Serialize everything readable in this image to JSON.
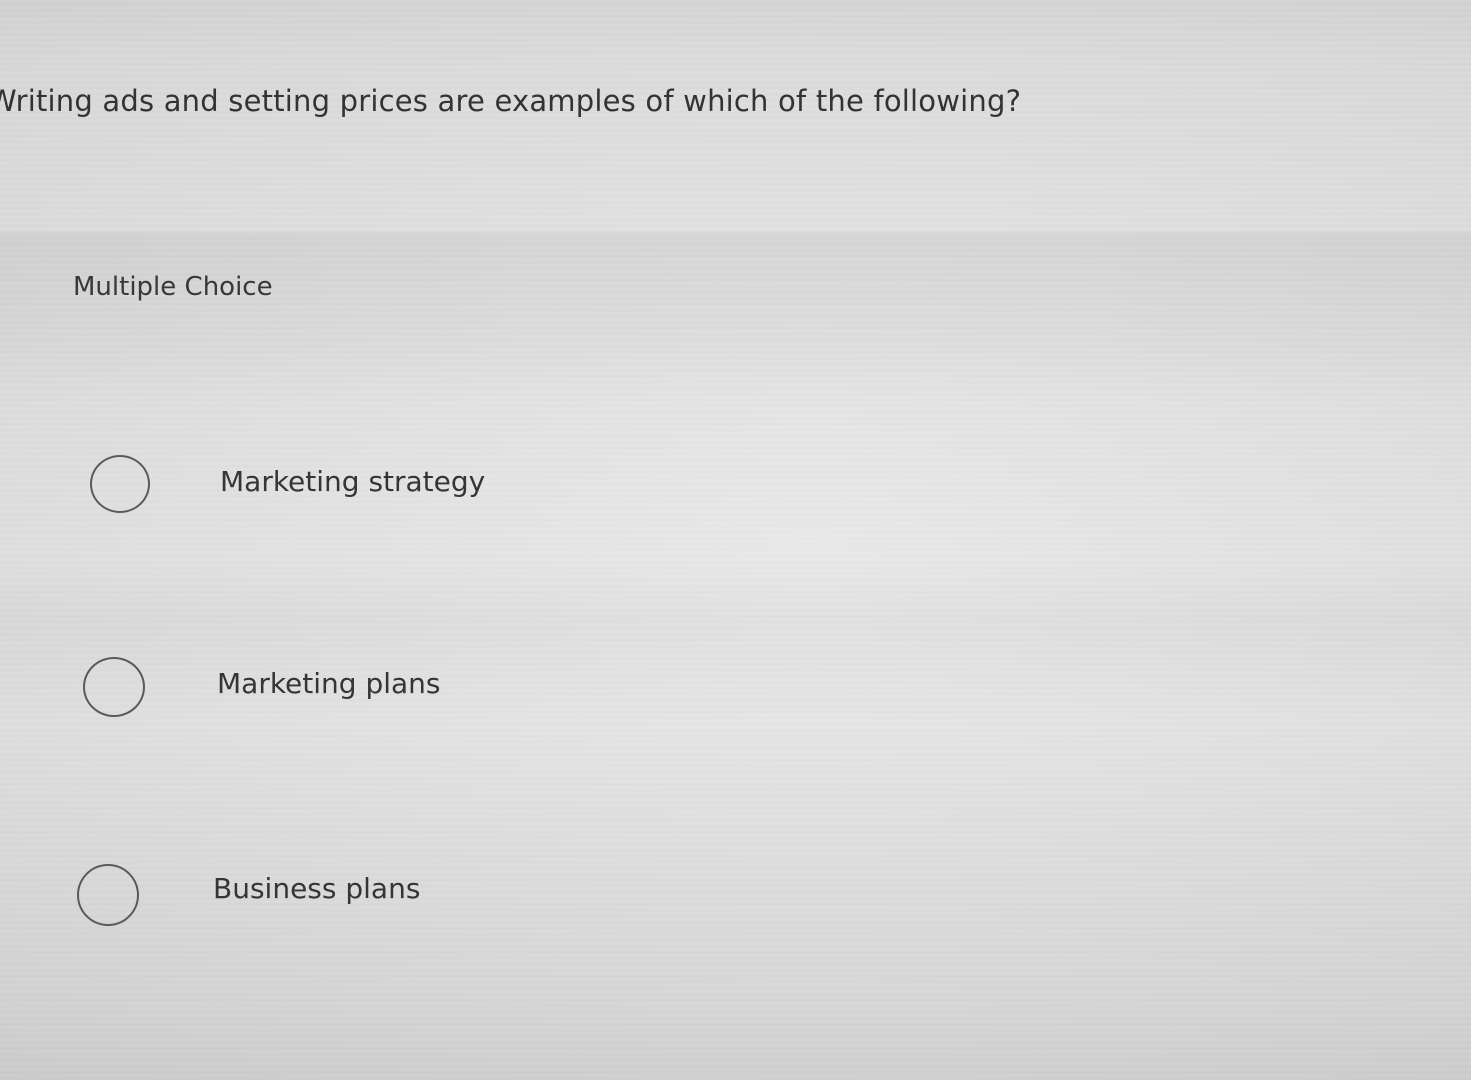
{
  "question": {
    "text": "Writing ads and setting prices are examples of which of the following?"
  },
  "question_type": {
    "label": "Multiple Choice"
  },
  "options": [
    {
      "label": "Marketing strategy",
      "selected": false
    },
    {
      "label": "Marketing plans",
      "selected": false
    },
    {
      "label": "Business plans",
      "selected": false
    }
  ]
}
